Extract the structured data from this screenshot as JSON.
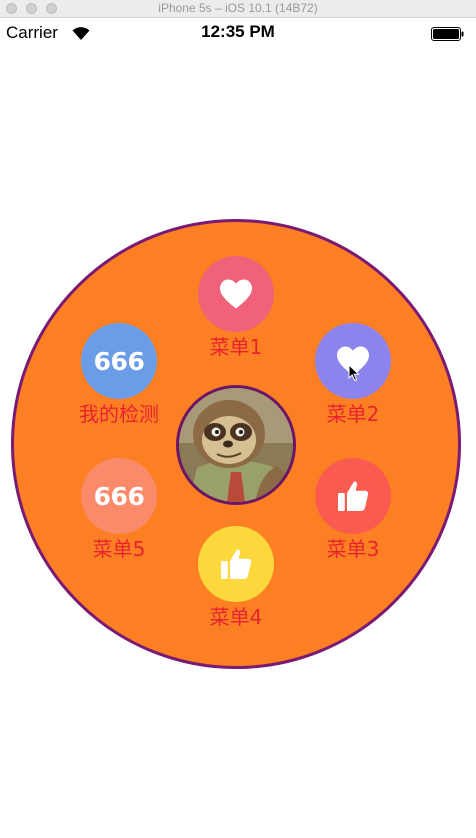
{
  "simulator": {
    "title": "iPhone 5s – iOS 10.1 (14B72)"
  },
  "status_bar": {
    "carrier": "Carrier",
    "time": "12:35 PM"
  },
  "menu": {
    "items": [
      {
        "label": "菜单1",
        "icon": "heart-icon",
        "color": "#f0617a"
      },
      {
        "label": "菜单2",
        "icon": "heart-icon",
        "color": "#8d83ec"
      },
      {
        "label": "菜单3",
        "icon": "thumbs-up-icon",
        "color": "#f95b50"
      },
      {
        "label": "菜单4",
        "icon": "thumbs-up-icon",
        "color": "#fcd83c"
      },
      {
        "label": "菜单5",
        "icon": "badge-666-icon",
        "icon_text": "666",
        "color": "#fb8a6a"
      },
      {
        "label": "我的检测",
        "icon": "badge-666-icon",
        "icon_text": "666",
        "color": "#6a9ce8"
      }
    ],
    "wheel_color": "#fc7f24",
    "wheel_border_color": "#7b1a73",
    "label_color": "#e8232f",
    "center": {
      "icon": "sloth-avatar"
    }
  }
}
